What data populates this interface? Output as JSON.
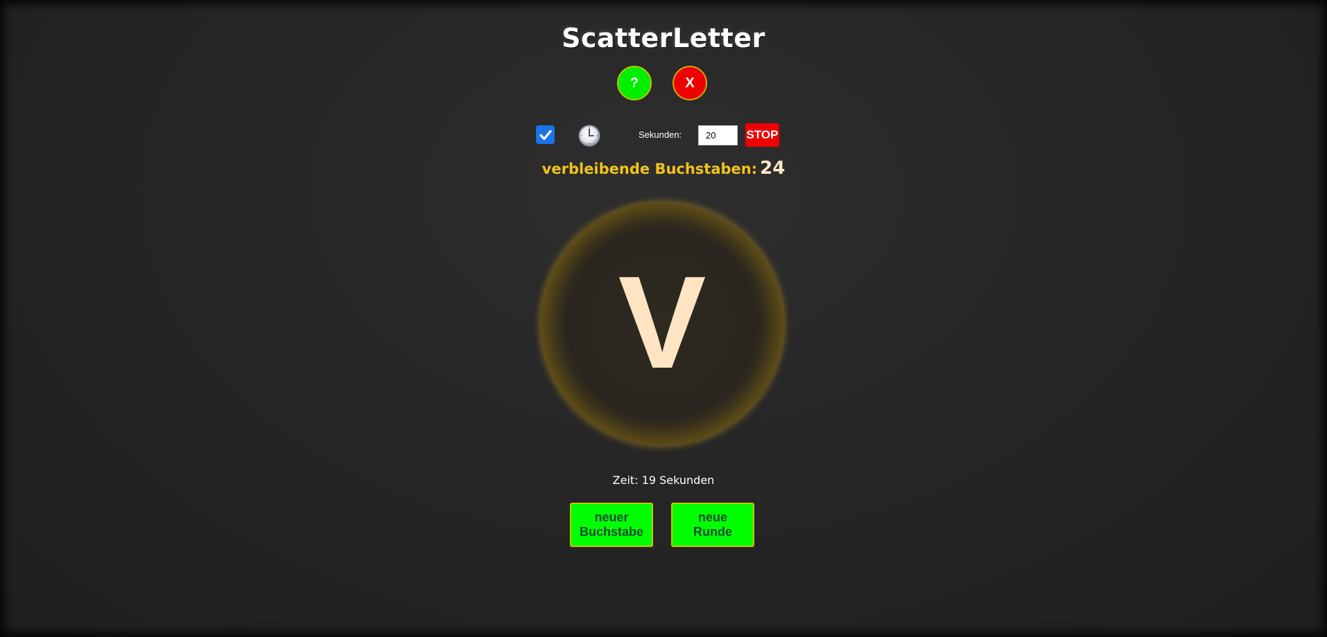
{
  "app": {
    "title": "ScatterLetter"
  },
  "header_buttons": {
    "help_label": "?",
    "close_label": "X"
  },
  "timer_controls": {
    "timer_enabled": true,
    "clock_icon": "clock-icon",
    "seconds_label": "Sekunden:",
    "seconds_value": "20",
    "stop_label": "STOP"
  },
  "status": {
    "remaining_label": "verbleibende Buchstaben:",
    "remaining_count": "24"
  },
  "game": {
    "current_letter": "V",
    "time_text": "Zeit: 19 Sekunden"
  },
  "actions": {
    "new_letter_label": "neuer Buchstabe",
    "new_round_label": "neue Runde"
  },
  "colors": {
    "green": "#00ff00",
    "red": "#ee0000",
    "gold": "#f2c41a",
    "letter": "#ffe4c4",
    "checkbox_blue": "#1a73e8"
  }
}
